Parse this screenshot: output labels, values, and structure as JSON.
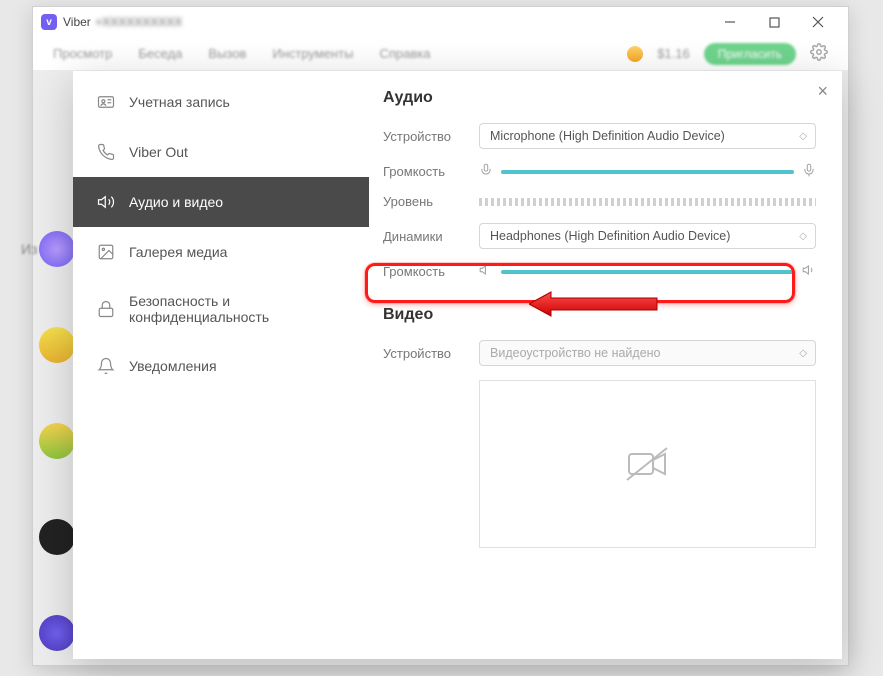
{
  "titlebar": {
    "app": "Viber",
    "phone": "+XXXXXXXXXX"
  },
  "topnav": {
    "items": [
      "Просмотр",
      "Беседа",
      "Вызов",
      "Инструменты",
      "Справка"
    ],
    "balance": "$1.16",
    "greenButton": "Пригласить"
  },
  "sideLabel": "Из",
  "settings": {
    "nav": {
      "account": "Учетная запись",
      "viberOut": "Viber Out",
      "audioVideo": "Аудио и видео",
      "media": "Галерея медиа",
      "privacy": "Безопасность и конфиденциальность",
      "notifications": "Уведомления"
    },
    "audio": {
      "heading": "Аудио",
      "deviceLabel": "Устройство",
      "deviceValue": "Microphone (High Definition Audio Device)",
      "volumeLabel": "Громкость",
      "levelLabel": "Уровень",
      "speakersLabel": "Динамики",
      "speakersValue": "Headphones (High Definition Audio Device)",
      "outVolumeLabel": "Громкость"
    },
    "video": {
      "heading": "Видео",
      "deviceLabel": "Устройство",
      "deviceValue": "Видеоустройство не найдено"
    }
  }
}
